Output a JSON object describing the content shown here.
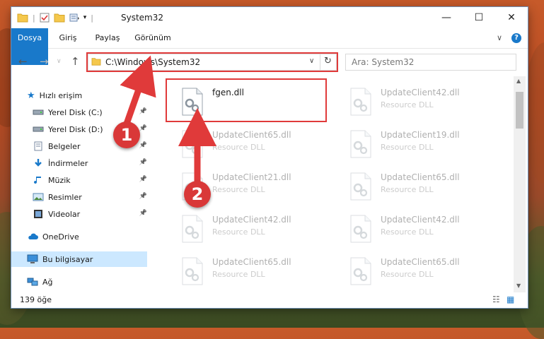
{
  "window": {
    "title": "System32",
    "controls": {
      "minimize": "—",
      "maximize": "☐",
      "close": "✕"
    }
  },
  "ribbon": {
    "tabs": [
      "Dosya",
      "Giriş",
      "Paylaş",
      "Görünüm"
    ],
    "expand_glyph": "∨",
    "help_glyph": "?"
  },
  "address": {
    "path": "C:\\Windows\\System32",
    "dropdown": "∨",
    "refresh": "↻"
  },
  "search": {
    "placeholder": "Ara: System32"
  },
  "nav": {
    "quick_access": "Hızlı erişim",
    "items": [
      {
        "label": "Yerel Disk (C:)",
        "icon": "drive-icon",
        "pinned": true
      },
      {
        "label": "Yerel Disk (D:)",
        "icon": "drive-icon",
        "pinned": true
      },
      {
        "label": "Belgeler",
        "icon": "documents-icon",
        "pinned": true
      },
      {
        "label": "İndirmeler",
        "icon": "downloads-icon",
        "pinned": true
      },
      {
        "label": "Müzik",
        "icon": "music-icon",
        "pinned": true
      },
      {
        "label": "Resimler",
        "icon": "pictures-icon",
        "pinned": true
      },
      {
        "label": "Videolar",
        "icon": "videos-icon",
        "pinned": true
      }
    ],
    "onedrive": "OneDrive",
    "this_pc": "Bu bilgisayar",
    "network": "Ağ"
  },
  "files": [
    {
      "name": "fgen.dll",
      "type": "",
      "highlight": true
    },
    {
      "name": "UpdateClient42.dll",
      "type": "Resource DLL"
    },
    {
      "name": "UpdateClient65.dll",
      "type": "Resource DLL"
    },
    {
      "name": "UpdateClient19.dll",
      "type": "Resource DLL"
    },
    {
      "name": "UpdateClient21.dll",
      "type": "Resource DLL"
    },
    {
      "name": "UpdateClient65.dll",
      "type": "Resource DLL"
    },
    {
      "name": "UpdateClient42.dll",
      "type": "Resource DLL"
    },
    {
      "name": "UpdateClient42.dll",
      "type": "Resource DLL"
    },
    {
      "name": "UpdateClient65.dll",
      "type": "Resource DLL"
    },
    {
      "name": "UpdateClient65.dll",
      "type": "Resource DLL"
    }
  ],
  "status": {
    "count": "139 öğe"
  },
  "annotations": {
    "badge1": "1",
    "badge2": "2",
    "color": "#e03a3a"
  },
  "colors": {
    "accent": "#1979ca",
    "selected_nav": "#cce8ff"
  }
}
